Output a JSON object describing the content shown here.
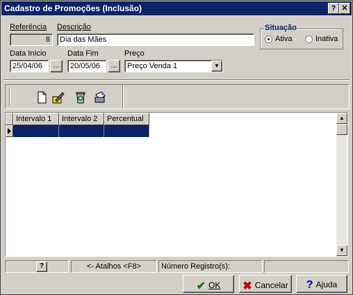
{
  "window": {
    "title": "Cadastro de Promoções (Inclusão)",
    "help_btn": "?",
    "close_btn": "✕"
  },
  "form": {
    "referencia_label": "Referência",
    "referencia_value": "8",
    "descricao_label": "Descrição",
    "descricao_value": "Dia das Mães",
    "situacao_label": "Situação",
    "ativa_label": "Ativa",
    "inativa_label": "Inativa",
    "data_inicio_label": "Data Início",
    "data_inicio_value": "25/04/06",
    "data_fim_label": "Data Fim",
    "data_fim_value": "20/05/06",
    "preco_label": "Preço",
    "preco_value": "Preço Venda 1",
    "ellipsis": "..."
  },
  "grid": {
    "columns": [
      "Intervalo 1",
      "Intervalo 2",
      "Percentual"
    ]
  },
  "statusbar": {
    "atalhos": "<- Atalhos <F8>",
    "registros": "Número Registro(s):"
  },
  "buttons": {
    "ok": "OK",
    "cancelar": "Cancelar",
    "ajuda": "Ajuda"
  }
}
